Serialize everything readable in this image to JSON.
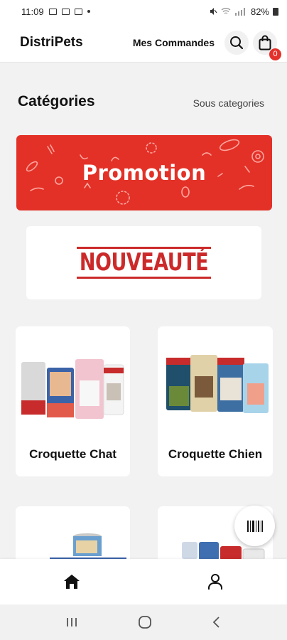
{
  "status_bar": {
    "time": "11:09",
    "battery": "82%"
  },
  "header": {
    "app_title": "DistriPets",
    "orders_label": "Mes Commandes",
    "cart_count": "0"
  },
  "categories": {
    "title": "Catégories",
    "subcategories_label": "Sous categories"
  },
  "banners": {
    "promotion": "Promotion",
    "new": "NOUVEAUTÉ"
  },
  "products": [
    {
      "label": "Croquette Chat"
    },
    {
      "label": "Croquette Chien"
    }
  ],
  "colors": {
    "accent_red": "#e33127",
    "stamp_red": "#cc2a2a"
  },
  "icons": {
    "search": "search-icon",
    "cart": "shopping-bag-icon",
    "barcode": "barcode-icon",
    "home": "home-icon",
    "profile": "user-icon"
  }
}
